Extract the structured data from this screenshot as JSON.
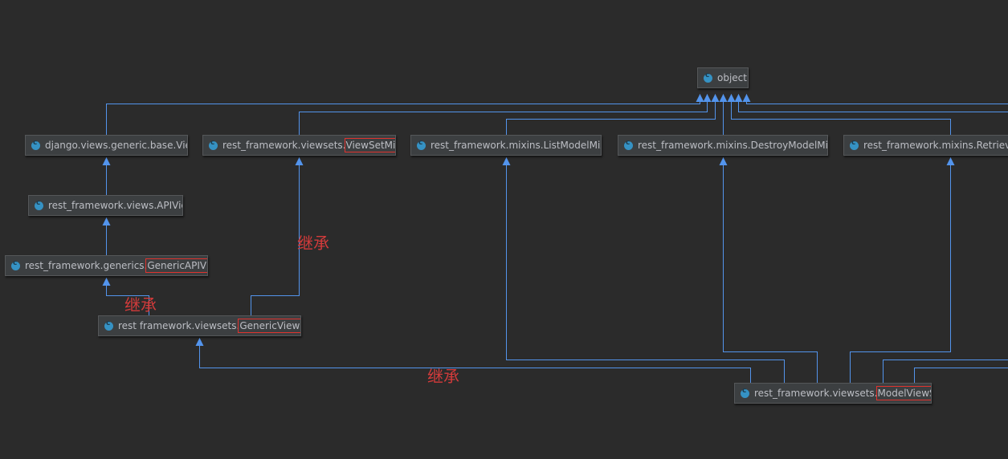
{
  "diagram": {
    "nodes": {
      "object": {
        "label": "object"
      },
      "django_view": {
        "label": "django.views.generic.base.View"
      },
      "api_view": {
        "label": "rest_framework.views.APIView"
      },
      "generic_api_view": {
        "prefix": "rest_framework.generics.",
        "highlight": "GenericAPIView"
      },
      "viewset_mixin": {
        "prefix": "rest_framework.viewsets.",
        "highlight": "ViewSetMixin"
      },
      "generic_viewset": {
        "prefix": "rest framework.viewsets.",
        "highlight": "GenericViewSet"
      },
      "list_model_mixin": {
        "label": "rest_framework.mixins.ListModelMixin"
      },
      "destroy_model_mixin": {
        "label": "rest_framework.mixins.DestroyModelMixin"
      },
      "retrieve_model_mixin": {
        "label": "rest_framework.mixins.RetrieveModelMixin"
      },
      "model_viewset": {
        "prefix": "rest_framework.viewsets.",
        "highlight": "ModelViewSet"
      }
    },
    "annotations": {
      "inherit_1": "继承",
      "inherit_2": "继承",
      "inherit_3": "继承"
    },
    "colors": {
      "edge": "#5394ec",
      "highlight_box": "#e0332e",
      "annotation": "#d43b3b",
      "node_bg": "#3c3f41",
      "background": "#2b2b2b"
    }
  }
}
